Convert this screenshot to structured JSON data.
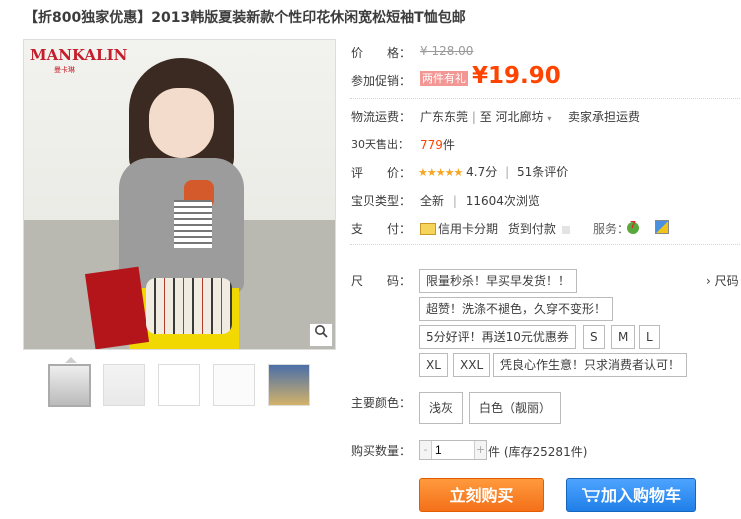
{
  "title": "【折800独家优惠】2013韩版夏装新款个性印花休闲宽松短袖T恤包邮",
  "image": {
    "logo": "MANKALIN",
    "logo_sub": "曼卡琳"
  },
  "price": {
    "label": "价　　格：",
    "original": "¥ 128.00"
  },
  "promo": {
    "label": "参加促销：",
    "tag": "两件有礼",
    "currency": "¥",
    "price": "19.90"
  },
  "shipping": {
    "label": "物流运费：",
    "from": "广东东莞",
    "to": "至  河北廊坊",
    "fee": "卖家承担运费"
  },
  "sales": {
    "label": "30天售出：",
    "count": "779",
    "unit": "件"
  },
  "rating": {
    "label": "评　　价：",
    "stars": "★★★★★",
    "score": "4.7分",
    "reviews": "51条评价",
    "star_value": 4.7
  },
  "item_type": {
    "label": "宝贝类型：",
    "condition": "全新",
    "views": "11604次浏览"
  },
  "payment": {
    "label": "支　　付：",
    "credit": "信用卡分期",
    "cod": "货到付款",
    "service_label": "服务："
  },
  "size": {
    "label": "尺　　码：",
    "chart_link": "尺码",
    "options": [
      "限量秒杀！早买早发货！！",
      "超赞！洗涤不褪色，久穿不变形！",
      "5分好评！再送10元优惠券",
      "S",
      "M",
      "L",
      "XL",
      "XXL",
      "凭良心作生意！只求消费者认可！"
    ]
  },
  "color": {
    "label": "主要颜色：",
    "options": [
      "浅灰",
      "白色（靓丽）"
    ]
  },
  "quantity": {
    "label": "购买数量：",
    "minus": "-",
    "value": "1",
    "plus": "+",
    "unit": "件",
    "stock": "(库存25281件)"
  },
  "buttons": {
    "buy": "立刻购买",
    "cart": "加入购物车"
  },
  "colors": {
    "accent": "#ff4400",
    "buy_button": "#f4701a",
    "cart_button": "#1f7fe8"
  },
  "icons": [
    "magnifier-icon",
    "credit-card-icon",
    "dropdown-arrow-icon",
    "service-seven-icon",
    "service-badge-icon",
    "cart-icon",
    "chevron-right-icon"
  ]
}
